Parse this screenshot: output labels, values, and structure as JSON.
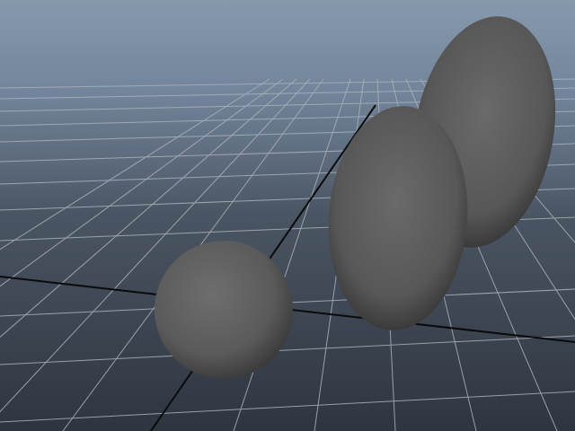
{
  "viewport": {
    "view": "perspective",
    "background_top_color": "#8699ad",
    "background_bottom_color": "#2f3540",
    "grid_line_color": "#a9b1bb",
    "axis_line_color": "#0b0b0b",
    "object_color": "#5e5e5e"
  },
  "scene": {
    "objects": [
      {
        "name": "sphere",
        "shape": "sphere"
      },
      {
        "name": "ellipsoid-front",
        "shape": "ellipsoid"
      },
      {
        "name": "ellipsoid-back",
        "shape": "ellipsoid"
      }
    ]
  }
}
